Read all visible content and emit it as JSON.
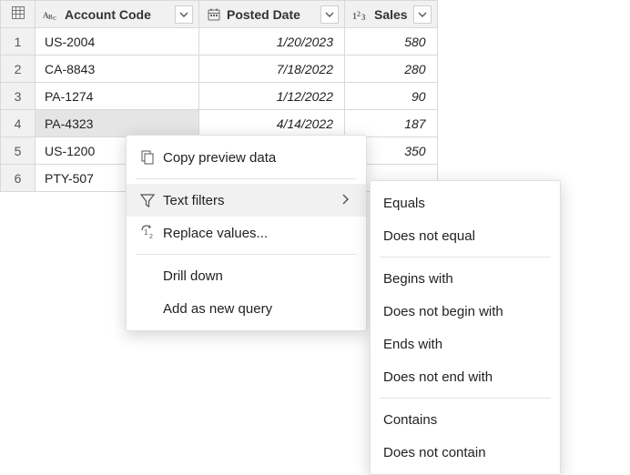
{
  "table": {
    "columns": [
      {
        "label": "Account Code",
        "kind": "text"
      },
      {
        "label": "Posted Date",
        "kind": "date"
      },
      {
        "label": "Sales",
        "kind": "number"
      }
    ],
    "rows": [
      {
        "n": "1",
        "acct": "US-2004",
        "date": "1/20/2023",
        "sales": "580"
      },
      {
        "n": "2",
        "acct": "CA-8843",
        "date": "7/18/2022",
        "sales": "280"
      },
      {
        "n": "3",
        "acct": "PA-1274",
        "date": "1/12/2022",
        "sales": "90"
      },
      {
        "n": "4",
        "acct": "PA-4323",
        "date": "4/14/2022",
        "sales": "187"
      },
      {
        "n": "5",
        "acct": "US-1200",
        "date": "",
        "sales": "350"
      },
      {
        "n": "6",
        "acct": "PTY-507",
        "date": "",
        "sales": ""
      }
    ],
    "selected_cell": {
      "row": 3,
      "col": "acct"
    }
  },
  "context_menu": {
    "copy_preview": "Copy preview data",
    "text_filters": "Text filters",
    "replace_values": "Replace values...",
    "drill_down": "Drill down",
    "add_as_new_query": "Add as new query"
  },
  "text_filters_submenu": {
    "equals": "Equals",
    "does_not_equal": "Does not equal",
    "begins_with": "Begins with",
    "does_not_begin_with": "Does not begin with",
    "ends_with": "Ends with",
    "does_not_end_with": "Does not end with",
    "contains": "Contains",
    "does_not_contain": "Does not contain"
  }
}
